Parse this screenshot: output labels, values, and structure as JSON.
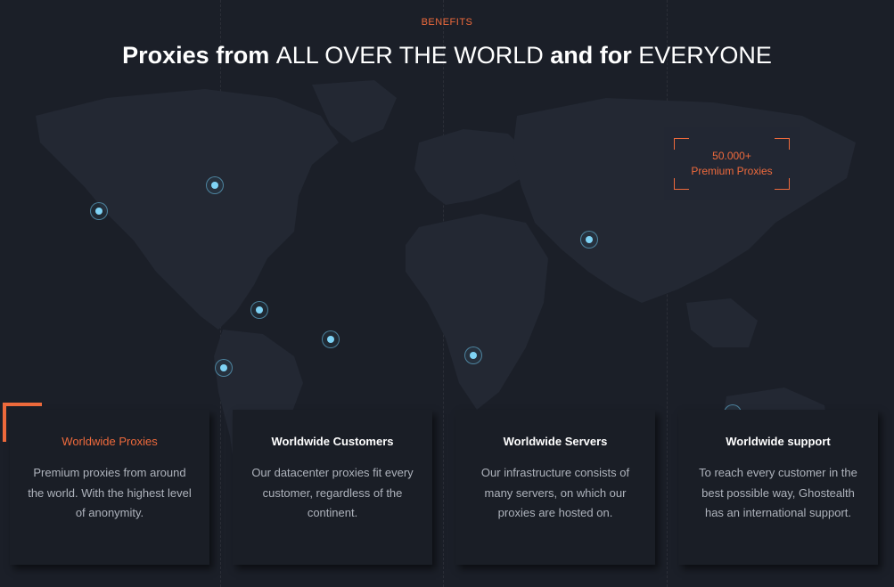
{
  "header": {
    "kicker": "BENEFITS",
    "title_part1": "Proxies from ",
    "title_part2": "ALL OVER THE WORLD",
    "title_part3": " and for ",
    "title_part4": "EVERYONE"
  },
  "stat_badge": {
    "value": "50.000+",
    "label": "Premium Proxies"
  },
  "colors": {
    "accent": "#ee6a3c",
    "pin": "#7fd3f5",
    "background": "#1b1f28"
  },
  "cards": [
    {
      "title": "Worldwide Proxies",
      "text": "Premium proxies from around the world. With the highest level of anonymity."
    },
    {
      "title": "Worldwide Customers",
      "text": "Our datacenter proxies fit every customer, regardless of the continent."
    },
    {
      "title": "Worldwide Servers",
      "text": "Our infrastructure consists of many servers, on which our proxies are hosted on."
    },
    {
      "title": "Worldwide support",
      "text": "To reach every customer in the best possible way, Ghostealth has an international support."
    }
  ]
}
